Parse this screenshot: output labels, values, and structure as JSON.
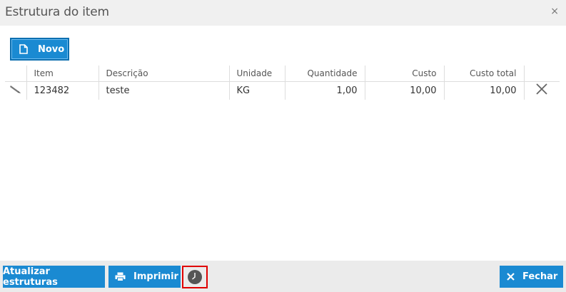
{
  "dialog": {
    "title": "Estrutura do item",
    "close_symbol": "×"
  },
  "toolbar": {
    "novo_label": "Novo",
    "novo_icon": "file-icon"
  },
  "table": {
    "columns": [
      "",
      "Item",
      "Descrição",
      "Unidade",
      "Quantidade",
      "Custo",
      "Custo total",
      ""
    ],
    "rows": [
      {
        "edit_icon": "pencil-icon",
        "item": "123482",
        "descricao": "teste",
        "unidade": "KG",
        "quantidade": "1,00",
        "custo": "10,00",
        "custo_total": "10,00",
        "delete_icon": "close-icon"
      }
    ]
  },
  "footer": {
    "atualizar_label": "Atualizar estruturas",
    "imprimir_label": "Imprimir",
    "imprimir_icon": "printer-icon",
    "history_icon": "clock-icon",
    "fechar_label": "Fechar",
    "fechar_icon": "close-icon"
  },
  "colors": {
    "primary": "#1a8ad2",
    "header_bg": "#f0f0f0",
    "footer_bg": "#ebebeb",
    "highlight": "#e00000"
  }
}
